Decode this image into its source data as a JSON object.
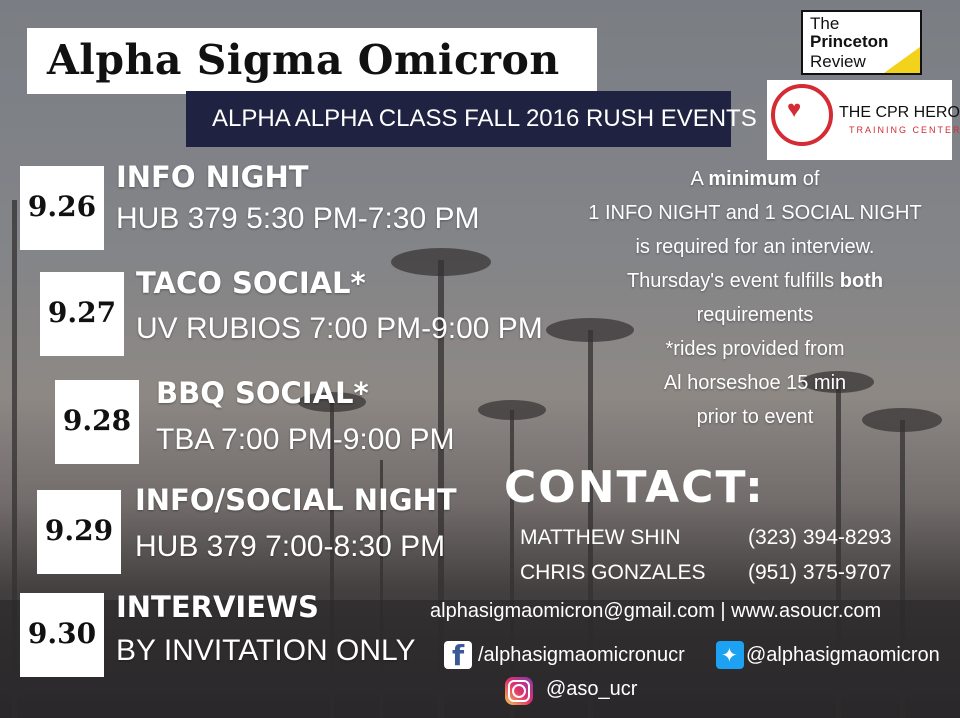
{
  "header": {
    "title": "Alpha Sigma Omicron",
    "subtitle": "ALPHA ALPHA CLASS FALL 2016 RUSH EVENTS"
  },
  "logos": {
    "princeton": {
      "line1": "The",
      "line2": "Princeton",
      "line3": "Review"
    },
    "cpr": {
      "name": "THE CPR HERO",
      "sub": "TRAINING CENTER"
    }
  },
  "events": [
    {
      "date": "9.26",
      "name": "INFO NIGHT",
      "detail": "HUB 379 5:30 PM-7:30 PM"
    },
    {
      "date": "9.27",
      "name": "TACO SOCIAL*",
      "detail": "UV RUBIOS 7:00 PM-9:00 PM"
    },
    {
      "date": "9.28",
      "name": "BBQ SOCIAL*",
      "detail": "TBA 7:00 PM-9:00 PM"
    },
    {
      "date": "9.29",
      "name": "INFO/SOCIAL NIGHT",
      "detail": "HUB 379 7:00-8:30 PM"
    },
    {
      "date": "9.30",
      "name": "INTERVIEWS",
      "detail": "BY INVITATION ONLY"
    }
  ],
  "note": {
    "l1a": "A ",
    "l1b": "minimum",
    "l1c": " of",
    "l2": "1 INFO NIGHT and 1 SOCIAL NIGHT",
    "l3": "is required for an interview.",
    "l4a": "Thursday's event fulfills ",
    "l4b": "both",
    "l5": "requirements",
    "l6": "*rides provided from",
    "l7": "Al horseshoe 15 min",
    "l8": "prior to event"
  },
  "contact": {
    "heading": "CONTACT:",
    "people": [
      {
        "name": "MATTHEW SHIN",
        "phone": "(323) 394-8293"
      },
      {
        "name": "CHRIS GONZALES",
        "phone": "(951) 375-9707"
      }
    ],
    "email_web": "alphasigmaomicron@gmail.com | www.asoucr.com",
    "facebook": "/alphasigmaomicronucr",
    "twitter": "@alphasigmaomicron",
    "instagram": "@aso_ucr"
  },
  "icons": {
    "facebook": "facebook-icon",
    "twitter": "twitter-icon",
    "instagram": "instagram-icon"
  },
  "colors": {
    "banner_navy": "#1f2341",
    "cpr_red": "#d42b35",
    "princeton_yellow": "#f2d21b"
  }
}
